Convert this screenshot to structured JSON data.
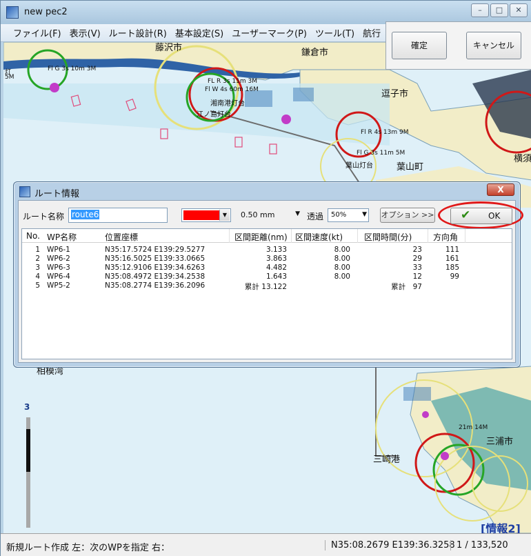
{
  "window": {
    "title": "new pec2",
    "min_label": "–",
    "max_label": "□",
    "close_label": "✕"
  },
  "menu": [
    "ファイル(F)",
    "表示(V)",
    "ルート設計(R)",
    "基本設定(S)",
    "ユーザーマーク(P)",
    "ツール(T)",
    "航行"
  ],
  "confirm_panel": {
    "confirm": "確定",
    "cancel": "キャンセル"
  },
  "map": {
    "places": {
      "kamakura": "鎌倉市",
      "fujisawa": "藤沢市",
      "zushi": "逗子市",
      "hayama": "葉山町",
      "yokosuka": "横須",
      "sagami_bay": "相模湾",
      "miura": "三浦市",
      "misaki": "三崎港",
      "enoshima": "江ノ島灯台",
      "shonan": "湘南港灯台",
      "hayama_light": "葉山灯台"
    },
    "light_labels": {
      "fl_g": "Fl G 3s 10m 3M",
      "fl_r": "FL R 3s 11m 3M",
      "fl_w": "Fl W 4s 60m 16M",
      "fl_r4": "Fl R 4s 13m 9M",
      "fl_g5": "Fl G 3s 11m 5M",
      "miura_light": "21m 14M",
      "left_light": "灯",
      "left_light2": "5M"
    },
    "scale_level": "3",
    "scale_level_fraction": 0.36,
    "info_label": "[情報2]"
  },
  "dialog": {
    "title": "ルート情報",
    "close_label": "X",
    "route_label": "ルート名称",
    "route_name": "route6",
    "line_color": "#ff0000",
    "line_width": "0.50 mm",
    "transparency_label": "透過",
    "transparency": "50%",
    "option_label": "オプション >>",
    "ok_label": "OK",
    "columns": [
      "No.",
      "WP名称",
      "位置座標",
      "区間距離(nm)",
      "区間速度(kt)",
      "区間時間(分)",
      "方向角"
    ],
    "rows": [
      {
        "no": "1",
        "name": "WP6-1",
        "pos": "N35:17.5724 E139:29.5277",
        "dist": "3.133",
        "speed": "8.00",
        "time": "23",
        "bearing": "111"
      },
      {
        "no": "2",
        "name": "WP6-2",
        "pos": "N35:16.5025 E139:33.0665",
        "dist": "3.863",
        "speed": "8.00",
        "time": "29",
        "bearing": "161"
      },
      {
        "no": "3",
        "name": "WP6-3",
        "pos": "N35:12.9106 E139:34.6263",
        "dist": "4.482",
        "speed": "8.00",
        "time": "33",
        "bearing": "185"
      },
      {
        "no": "4",
        "name": "WP6-4",
        "pos": "N35:08.4972 E139:34.2538",
        "dist": "1.643",
        "speed": "8.00",
        "time": "12",
        "bearing": "99"
      },
      {
        "no": "5",
        "name": "WP5-2",
        "pos": "N35:08.2774 E139:36.2096",
        "dist": "累計 13.122",
        "speed": "",
        "time": "累計　97",
        "bearing": ""
      }
    ]
  },
  "status": {
    "message": "新規ルート作成 左：次のWPを指定 右：",
    "coord": "N35:08.2679 E139:36.3258",
    "scale": "1 / 133,520"
  },
  "colors": {
    "water": "#dff0f8",
    "land": "#f2edc8",
    "route_red": "#ff0000",
    "accent_ring": "#e01818"
  }
}
